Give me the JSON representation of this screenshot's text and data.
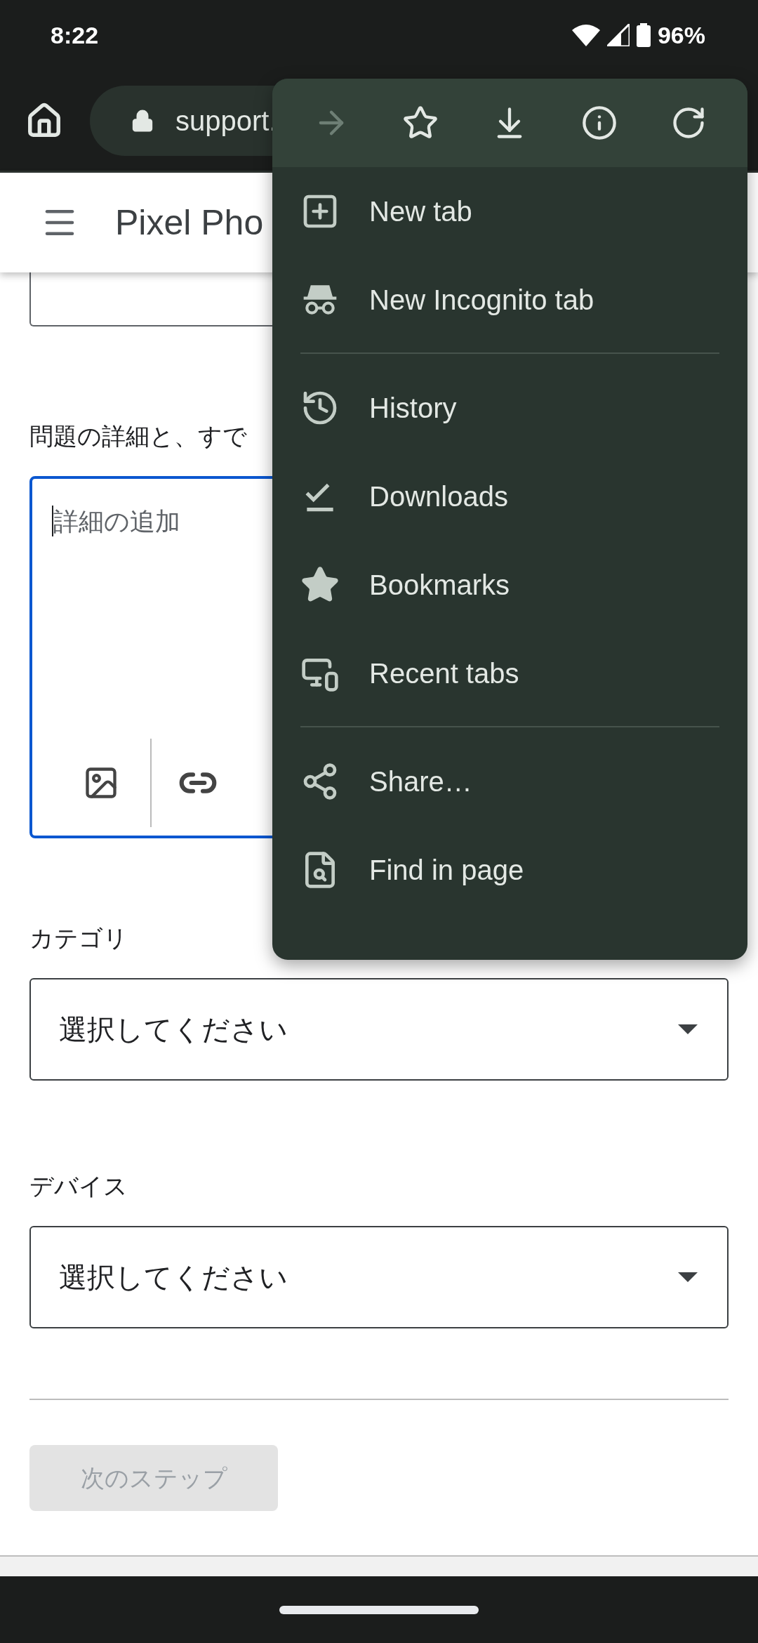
{
  "status_bar": {
    "time": "8:22",
    "battery": "96%"
  },
  "toolbar": {
    "url": "support."
  },
  "header": {
    "title": "Pixel Pho"
  },
  "form": {
    "question_label": "問題の詳細と、すで",
    "details": {
      "placeholder": "詳細の追加"
    },
    "fields": [
      {
        "label": "カテゴリ",
        "value": "選択してください"
      },
      {
        "label": "デバイス",
        "value": "選択してください"
      }
    ],
    "next_button": {
      "label": "次のステップ",
      "disabled": true
    }
  },
  "menu": {
    "actions": [
      {
        "kind": "forward",
        "disabled": true
      },
      {
        "kind": "bookmark",
        "disabled": false
      },
      {
        "kind": "download",
        "disabled": false
      },
      {
        "kind": "info",
        "disabled": false
      },
      {
        "kind": "reload",
        "disabled": false
      }
    ],
    "sections": [
      [
        {
          "kind": "new-tab",
          "label": "New tab"
        },
        {
          "kind": "incognito",
          "label": "New Incognito tab"
        }
      ],
      [
        {
          "kind": "history",
          "label": "History"
        },
        {
          "kind": "downloads",
          "label": "Downloads"
        },
        {
          "kind": "bookmarks",
          "label": "Bookmarks"
        },
        {
          "kind": "recent-tabs",
          "label": "Recent tabs"
        }
      ],
      [
        {
          "kind": "share",
          "label": "Share…"
        },
        {
          "kind": "find",
          "label": "Find in page"
        }
      ]
    ]
  }
}
